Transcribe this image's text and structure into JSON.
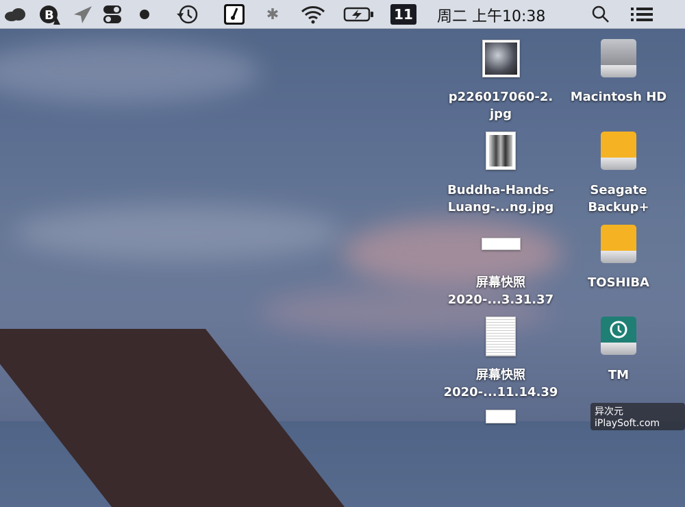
{
  "menubar": {
    "icons": [
      "onedrive-icon",
      "bartender-icon",
      "airmail-icon",
      "toggle-icon",
      "dot-icon",
      "time-machine-icon",
      "istat-icon",
      "bluetooth-icon",
      "wifi-icon",
      "battery-charging-icon",
      "calendar-icon",
      "spotlight-icon",
      "control-center-icon"
    ],
    "calendar_day": "11",
    "clock": "周二 上午10:38"
  },
  "desktop": {
    "files": [
      {
        "name": "p226017060-2.\njpg",
        "line1": "p226017060-2.",
        "line2": "jpg"
      },
      {
        "line1": "Buddha-Hands-",
        "line2": "Luang-...ng.jpg"
      },
      {
        "line1": "屏幕快照",
        "line2": "2020-...3.31.37"
      },
      {
        "line1": "屏幕快照",
        "line2": "2020-...11.14.39"
      }
    ],
    "drives": [
      {
        "line1": "Macintosh HD",
        "color": "#9a9ca2"
      },
      {
        "line1": "Seagate",
        "line2": "Backup+",
        "color": "#f5b323"
      },
      {
        "line1": "TOSHIBA",
        "color": "#f5b323"
      },
      {
        "line1": "TM",
        "color": "#1f7f74"
      }
    ]
  },
  "watermark": "异次元 iPlaySoft.com"
}
